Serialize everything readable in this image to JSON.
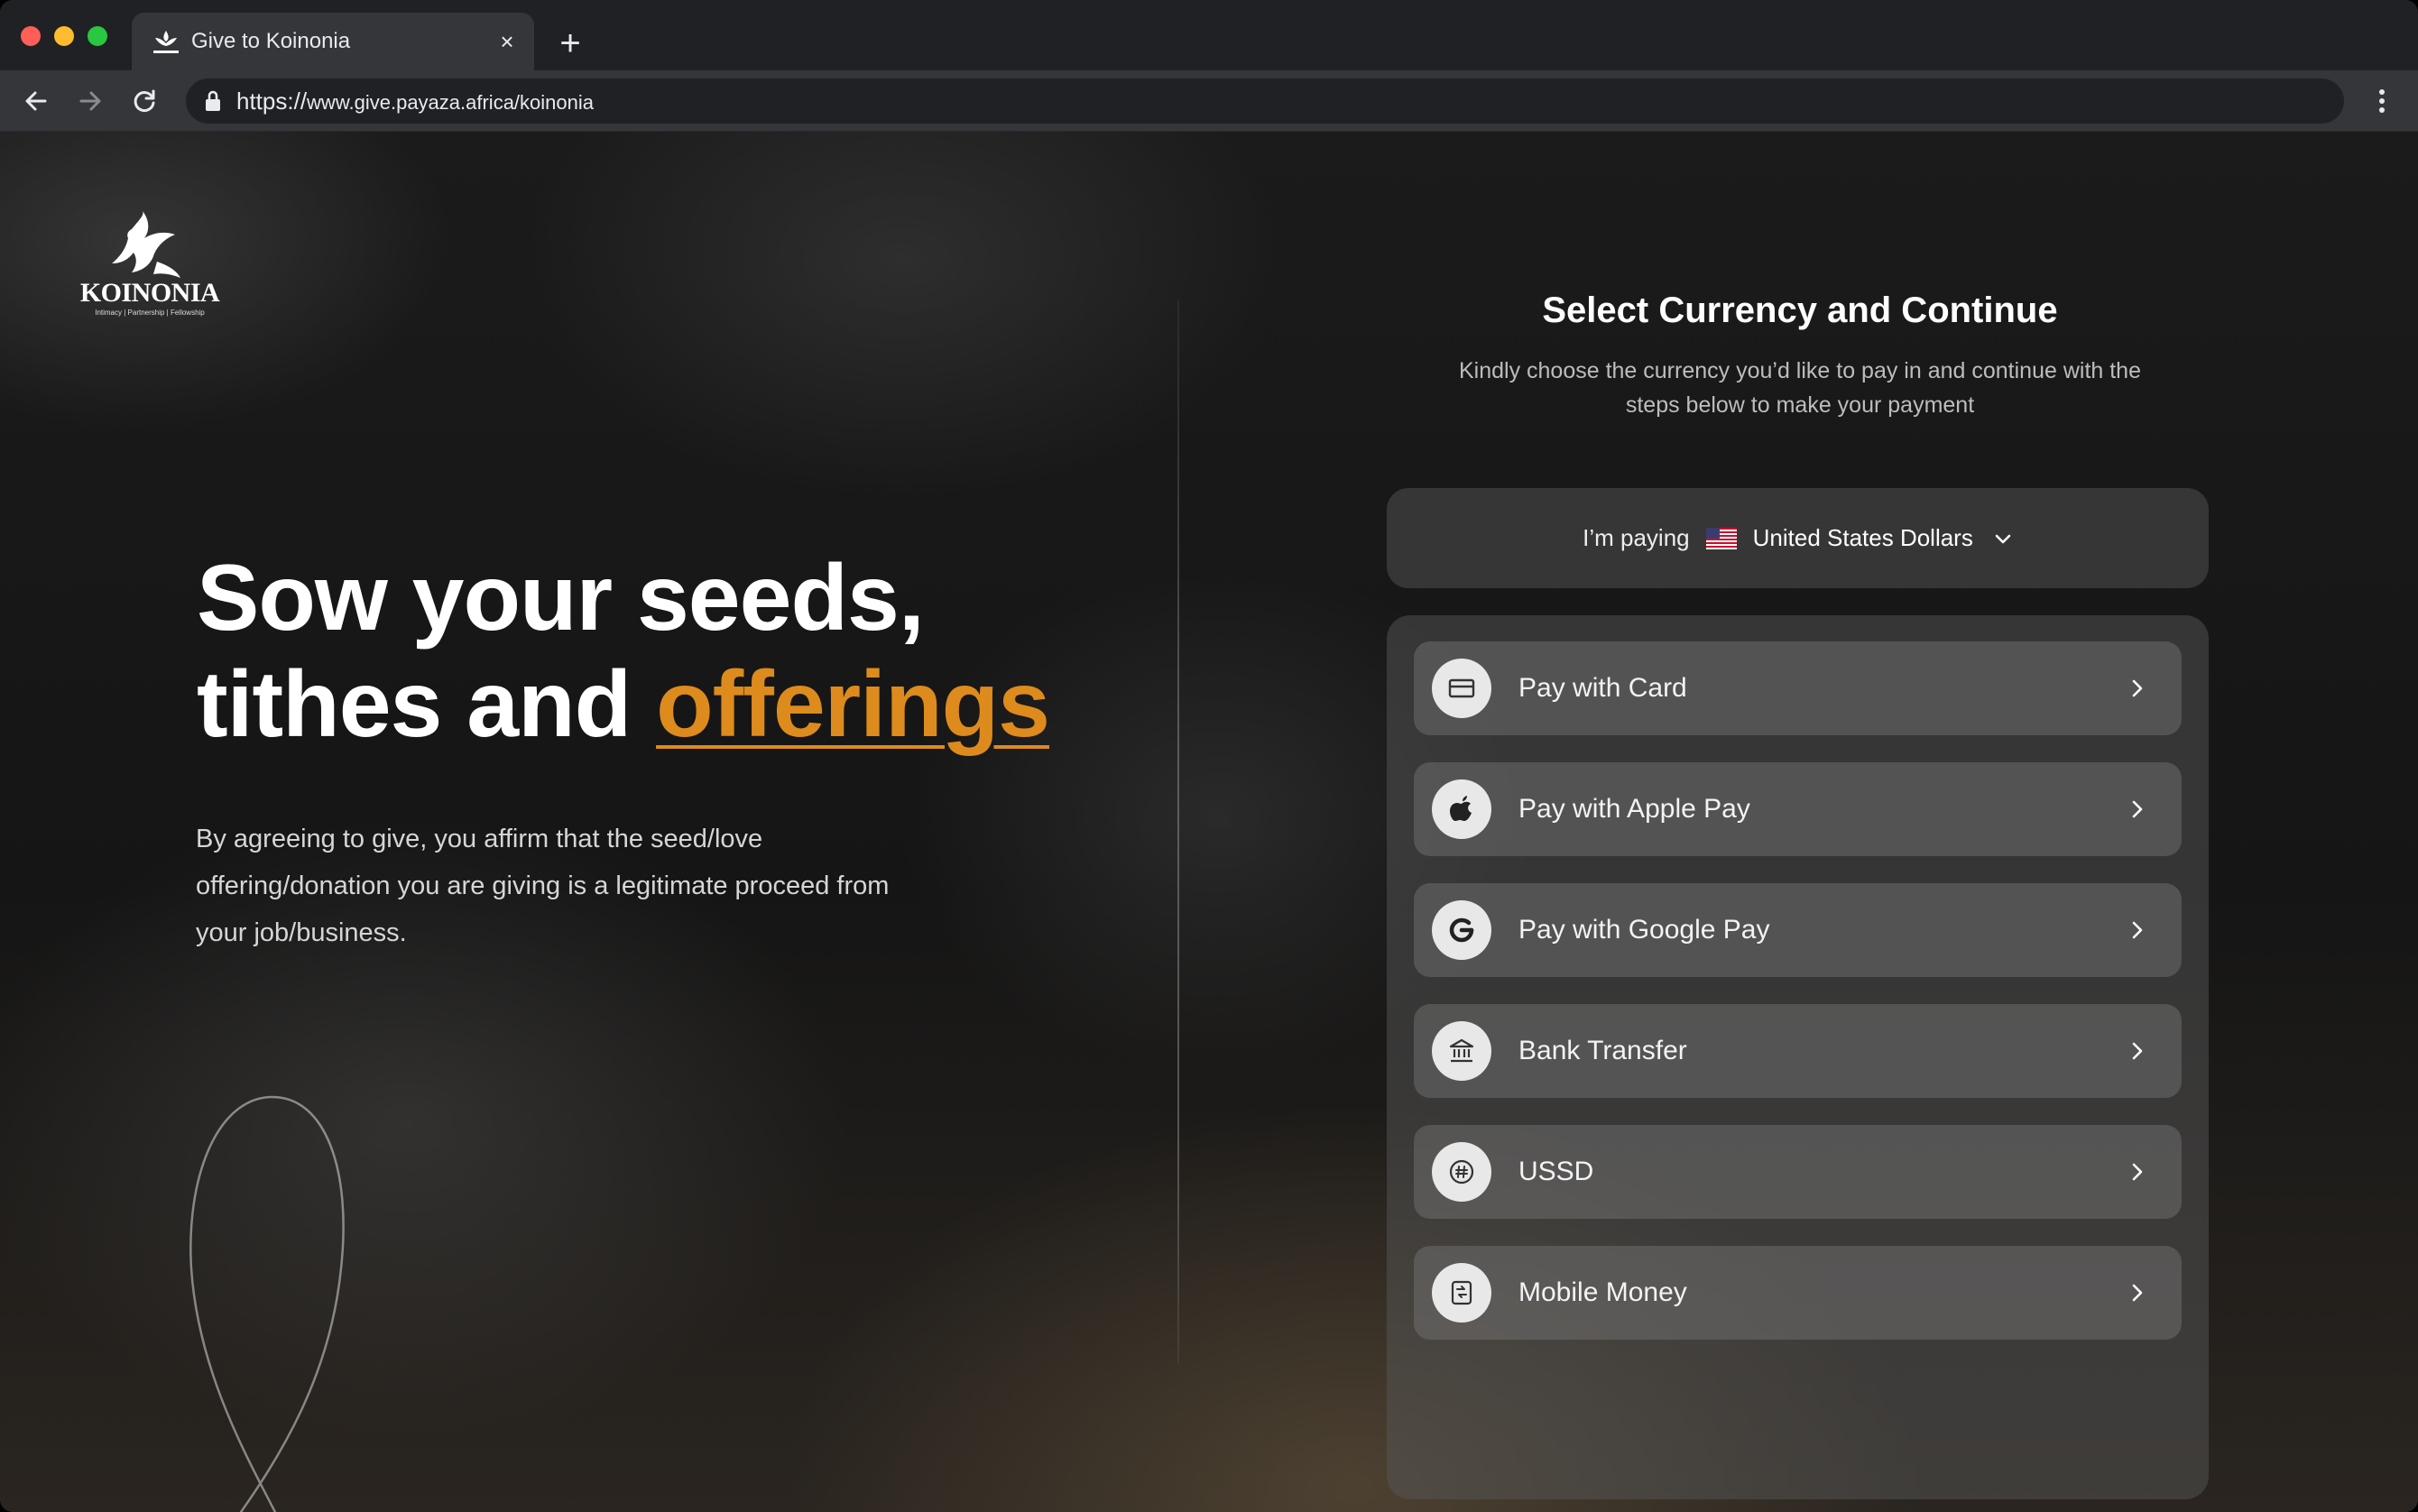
{
  "browser": {
    "tab_title": "Give to Koinonia",
    "tab_close": "×",
    "new_tab": "+",
    "url_scheme": "https://",
    "url_host": "www.give.payaza.africa/koinonia"
  },
  "brand": {
    "name": "KOINONIA",
    "tagline": "Intimacy | Partnership | Fellowship"
  },
  "hero": {
    "line1": "Sow your seeds,",
    "line2_prefix": "tithes and ",
    "line2_accent": "offerings",
    "accent_color": "#dd8b1d",
    "description": "By agreeing to give, you affirm that the seed/love offering/donation you are giving  is a legitimate proceed from your job/business."
  },
  "panel": {
    "title": "Select Currency and Continue",
    "subtitle": "Kindly choose the currency you’d like to pay in and continue with the steps below to make your payment",
    "currency_label": "I’m paying",
    "currency_value": "United States Dollars",
    "currency_flag": "us-flag-icon"
  },
  "methods": [
    {
      "label": "Pay with Card",
      "icon": "card-icon"
    },
    {
      "label": "Pay with Apple Pay",
      "icon": "apple-icon"
    },
    {
      "label": "Pay with Google Pay",
      "icon": "google-icon"
    },
    {
      "label": "Bank Transfer",
      "icon": "bank-icon"
    },
    {
      "label": "USSD",
      "icon": "hash-icon"
    },
    {
      "label": "Mobile Money",
      "icon": "mobile-money-icon"
    }
  ]
}
